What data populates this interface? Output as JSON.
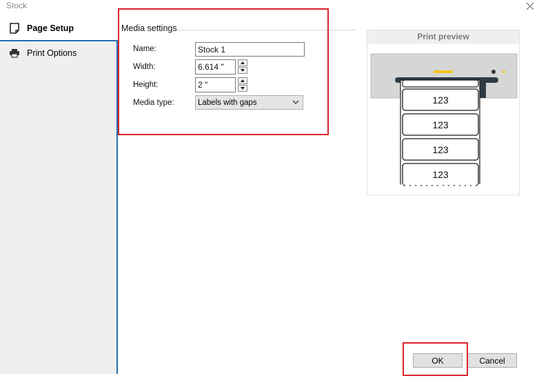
{
  "window": {
    "title": "Stock",
    "close_icon": "close-icon"
  },
  "sidebar": {
    "items": [
      {
        "label": "Page Setup",
        "icon": "page-setup-icon",
        "active": true
      },
      {
        "label": "Print Options",
        "icon": "printer-icon",
        "active": false
      }
    ]
  },
  "media_settings": {
    "title": "Media settings",
    "name": {
      "label": "Name:",
      "value": "Stock 1"
    },
    "width": {
      "label": "Width:",
      "value": "6.614 \""
    },
    "height": {
      "label": "Height:",
      "value": "2 \""
    },
    "media_type": {
      "label": "Media type:",
      "value": "Labels with gaps"
    }
  },
  "preview": {
    "title": "Print preview",
    "labels": [
      "123",
      "123",
      "123",
      "123"
    ]
  },
  "buttons": {
    "ok": "OK",
    "cancel": "Cancel"
  },
  "colors": {
    "highlight": "#d9232d",
    "accent": "#1f6fb5",
    "printer_light": "#f5c518"
  }
}
